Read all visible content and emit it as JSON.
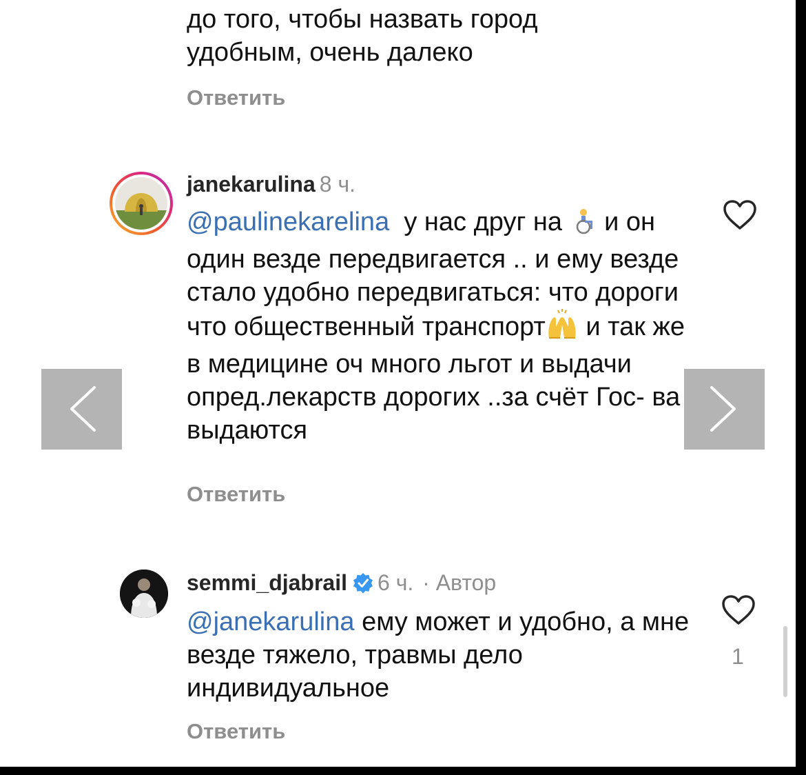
{
  "comments": [
    {
      "text_lines": [
        "до того, чтобы назвать город",
        "удобным, очень далеко"
      ],
      "reply_label": "Ответить"
    },
    {
      "username": "janekarulina",
      "time": "8 ч.",
      "mention": "@paulinekarelina",
      "body_part1": "у нас друг на",
      "emoji1": "person-in-wheelchair-emoji",
      "body_part2": "и он один везде передвигается .. и ему везде стало удобно передвигаться: что дороги что общественный транспорт",
      "emoji2": "raising-hands-emoji",
      "body_part3": "и так же в медицине оч много льгот и выдачи опред.лекарств дорогих ..за счёт Гос- ва выдаются",
      "reply_label": "Ответить"
    },
    {
      "username": "semmi_djabrail",
      "time": "6 ч.",
      "author_badge": "· Автор",
      "mention": "@janekarulina",
      "body": "ему может и удобно, а мне везде тяжело, травмы дело индивидуальное",
      "likes": "1",
      "reply_label": "Ответить"
    }
  ],
  "icons": {
    "like": "heart-outline-icon",
    "verified": "verified-badge-icon",
    "prev": "chevron-left-icon",
    "next": "chevron-right-icon"
  },
  "colors": {
    "mention": "#3a6fb3",
    "secondary": "#8e8e8e",
    "verified": "#3897f0",
    "nav_button": "#b4b4b4"
  }
}
